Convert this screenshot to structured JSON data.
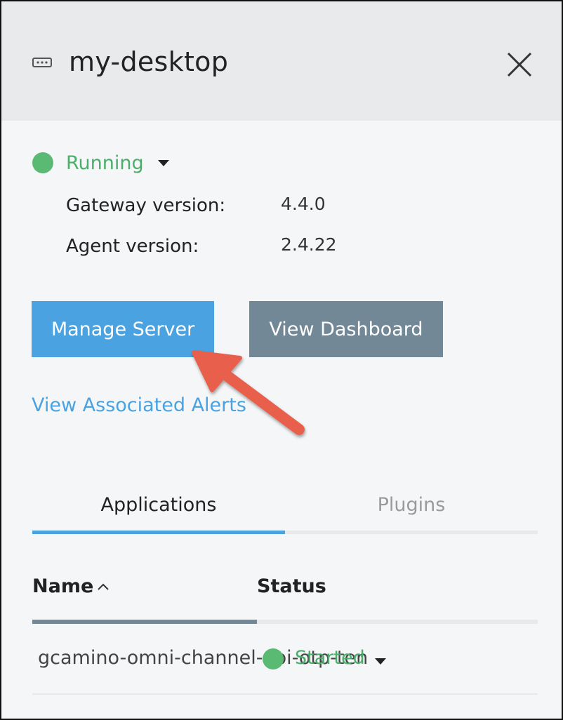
{
  "header": {
    "title": "my-desktop",
    "server_icon": "server-icon",
    "close_icon": "close-icon"
  },
  "status": {
    "label": "Running",
    "color": "#5ab973"
  },
  "info": {
    "gateway_label": "Gateway version:",
    "gateway_value": "4.4.0",
    "agent_label": "Agent version:",
    "agent_value": "2.4.22"
  },
  "actions": {
    "manage_server": "Manage Server",
    "view_dashboard": "View Dashboard",
    "view_alerts": "View Associated Alerts"
  },
  "tabs": [
    {
      "label": "Applications",
      "active": true
    },
    {
      "label": "Plugins",
      "active": false
    }
  ],
  "table": {
    "columns": [
      "Name",
      "Status"
    ],
    "sort_icon": "sort-ascending-icon",
    "rows": [
      {
        "name": "gcamino-omni-channel-api-otp-ten",
        "status": "Started"
      }
    ]
  },
  "colors": {
    "accent": "#4aa3e0",
    "secondary": "#728897",
    "success": "#4cae6b",
    "annotation_arrow": "#e8604c"
  }
}
